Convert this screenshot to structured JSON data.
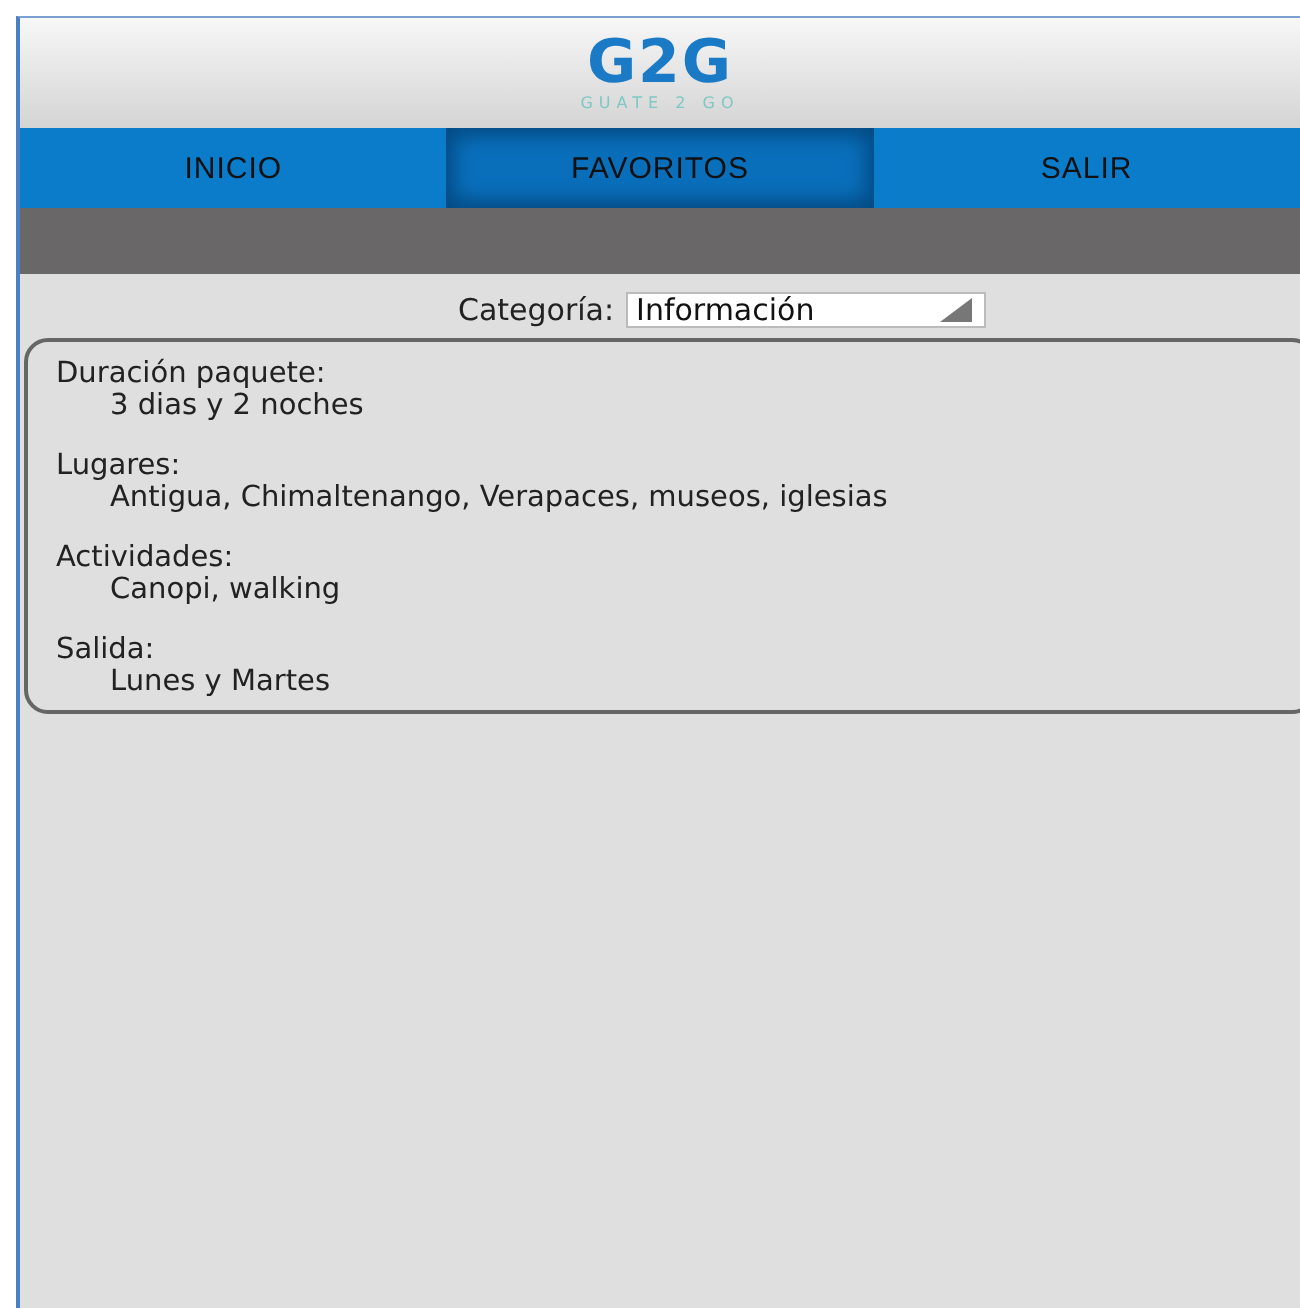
{
  "header": {
    "logo": "G2G",
    "tagline": "GUATE 2 GO"
  },
  "tabs": [
    {
      "label": "INICIO",
      "selected": false
    },
    {
      "label": "FAVORITOS",
      "selected": true
    },
    {
      "label": "SALIR",
      "selected": false
    }
  ],
  "category": {
    "label": "Categoría:",
    "value": "Información"
  },
  "details": [
    {
      "label": "Duración paquete:",
      "value": "3 dias y 2 noches"
    },
    {
      "label": "Lugares:",
      "value": "Antigua, Chimaltenango, Verapaces, museos, iglesias"
    },
    {
      "label": "Actividades:",
      "value": "Canopi, walking"
    },
    {
      "label": "Salida:",
      "value": "Lunes y Martes"
    }
  ]
}
